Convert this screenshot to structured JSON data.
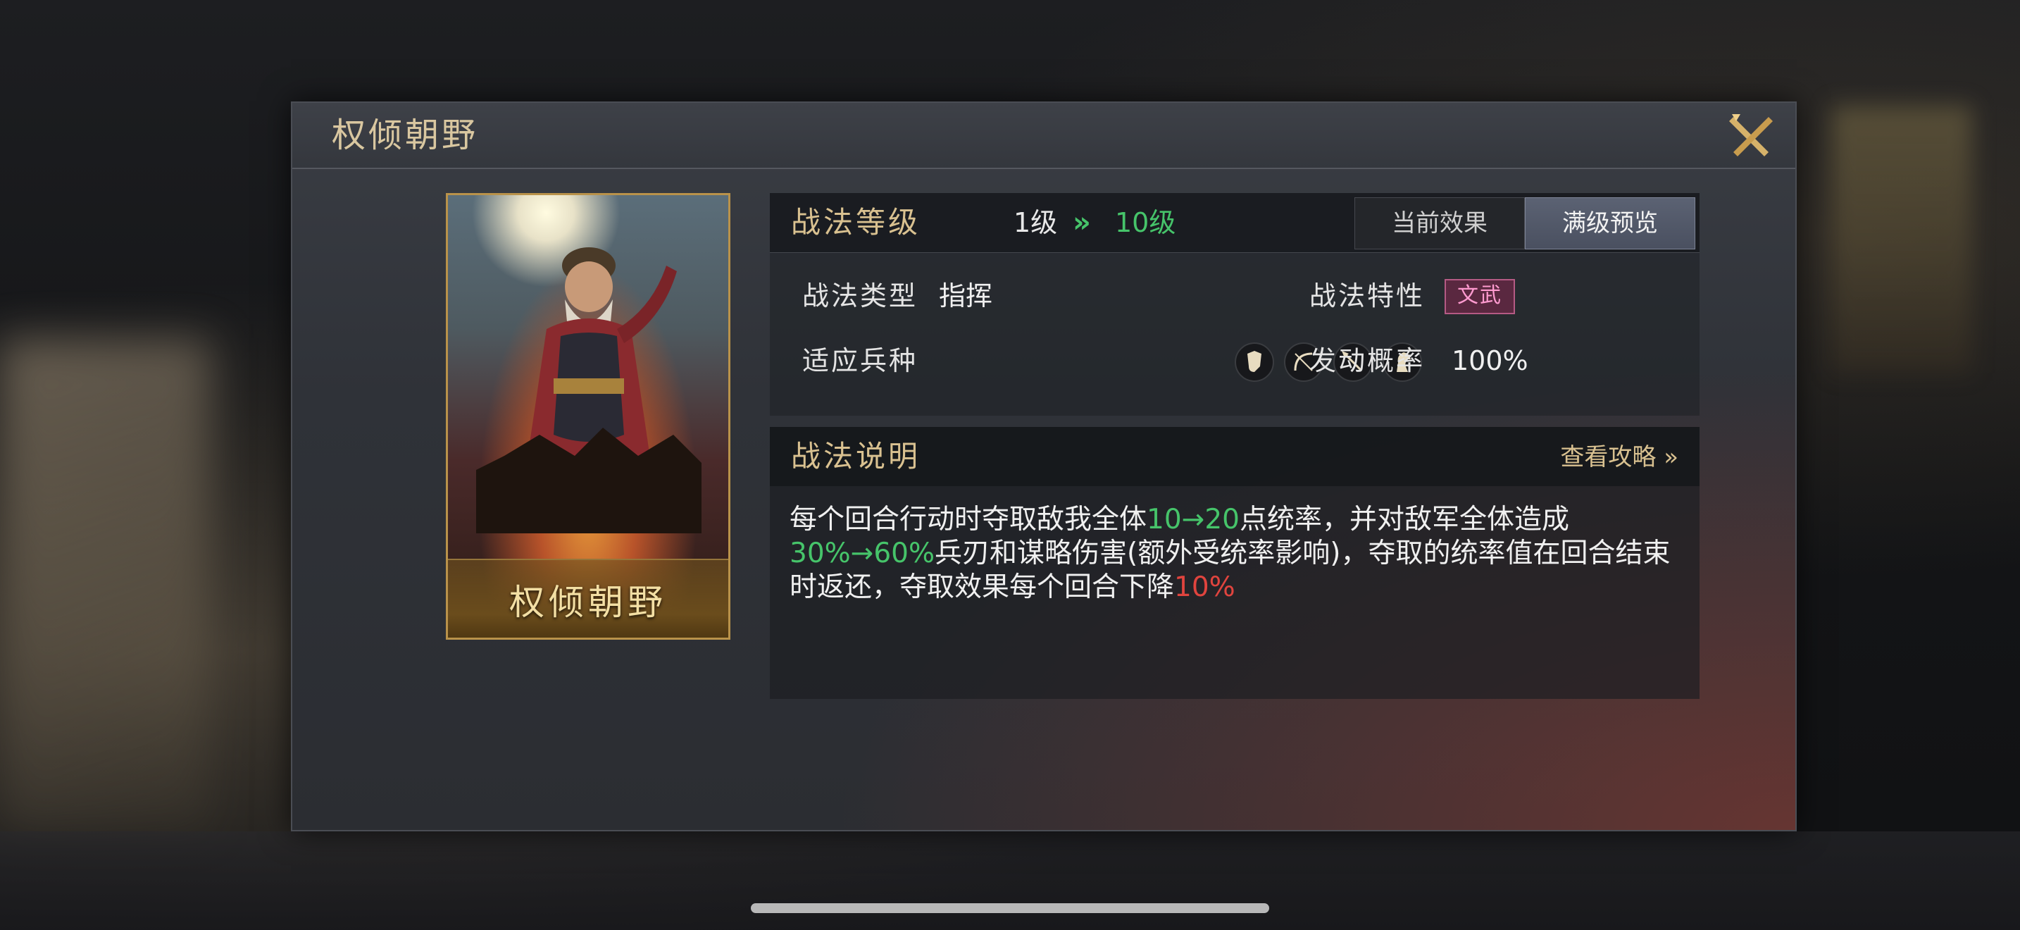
{
  "modal": {
    "title": "权倾朝野"
  },
  "card": {
    "name": "权倾朝野"
  },
  "level": {
    "label": "战法等级",
    "from": "1级",
    "arrow": "»",
    "to": "10级",
    "tabs": [
      "当前效果",
      "满级预览"
    ],
    "active_tab": "满级预览"
  },
  "attributes": {
    "type_label": "战法类型",
    "type_value": "指挥",
    "trait_label": "战法特性",
    "trait_value": "文武",
    "troops_label": "适应兵种",
    "troops": [
      "shield-troop-icon",
      "bow-troop-icon",
      "spear-troop-icon",
      "horse-troop-icon"
    ],
    "chance_label": "发动概率",
    "chance_value": "100%"
  },
  "description": {
    "title": "战法说明",
    "guide_link": "查看攻略 »",
    "segments": [
      {
        "text": "每个回合行动时夺取敌我全体",
        "color": "white"
      },
      {
        "text": "10→20",
        "color": "green"
      },
      {
        "text": "点统率，并对敌军全体造成",
        "color": "white"
      },
      {
        "text": "30%→60%",
        "color": "green"
      },
      {
        "text": "兵刃和谋略伤害(额外受统率影响)，夺取的统率值在回合结束时返还，夺取效果每个回合下降",
        "color": "white"
      },
      {
        "text": "10%",
        "color": "red"
      }
    ]
  },
  "colors": {
    "gold_text": "#d9c190",
    "green_value": "#46c46a",
    "red_value": "#e0443e",
    "trait_badge": "#5a2840"
  }
}
